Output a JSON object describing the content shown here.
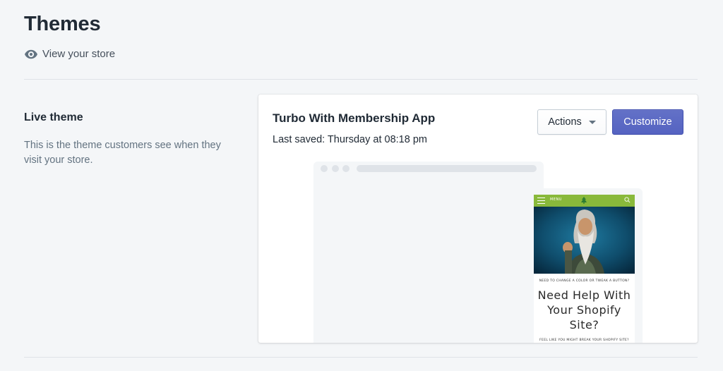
{
  "header": {
    "title": "Themes",
    "view_store_label": "View your store",
    "view_store_icon": "eye-icon"
  },
  "live_theme_section": {
    "heading": "Live theme",
    "description": "This is the theme customers see when they visit your store."
  },
  "theme_card": {
    "theme_name": "Turbo With Membership App",
    "last_saved": "Last saved: Thursday at 08:18 pm",
    "actions_label": "Actions",
    "customize_label": "Customize"
  },
  "mobile_preview": {
    "menu_label": "MENU",
    "kicker": "NEED TO CHANGE A COLOR OR TWEAK A BUTTON?",
    "headline": "Need Help With Your Shopify Site?",
    "subtext": "FEEL LIKE YOU MIGHT BREAK YOUR SHOPIFY SITE?"
  },
  "colors": {
    "primary": "#5c6ac4",
    "page_background": "#f4f6f8",
    "mobile_header": "#89b93b",
    "text_subdued": "#637381"
  }
}
